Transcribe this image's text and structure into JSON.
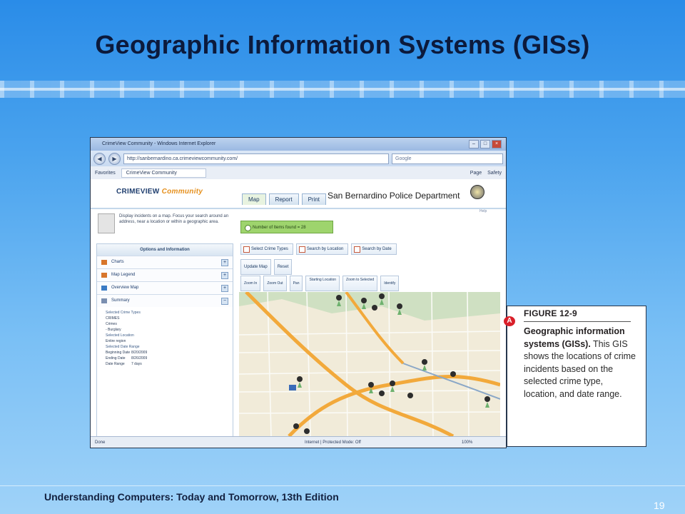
{
  "slide": {
    "title": "Geographic Information Systems (GISs)",
    "footer": "Understanding Computers: Today and Tomorrow, 13th Edition",
    "page_number": "19"
  },
  "browser": {
    "window_title": "CrimeView Community - Windows Internet Explorer",
    "url": "http://sanbernardino.ca.crimeviewcommunity.com/",
    "search_placeholder": "Google",
    "favorites_label": "Favorites",
    "tab_label": "CrimeView Community",
    "menu_page": "Page",
    "menu_safety": "Safety",
    "status_left": "Done",
    "status_zone": "Internet | Protected Mode: Off",
    "zoom": "100%"
  },
  "app": {
    "logo_main": "CRIMEVIEW",
    "logo_sub": "Community",
    "department": "San Bernardino Police Department",
    "tabs": [
      "Map",
      "Report",
      "Print"
    ],
    "help": "Help",
    "intro_text": "Display incidents on a map. Focus your search around an address, near a location or within a geographic area.",
    "incident_count": "Number of Items found = 28",
    "panel_header": "Options and Information",
    "panel_rows": [
      "Charts",
      "Map Legend",
      "Overview Map",
      "Summary"
    ],
    "summary": {
      "crime_types_head": "Selected Crime Types",
      "crimes_label": "CRIMES",
      "crimes_sub": "Crimes",
      "burglary": "- Burglary",
      "location_head": "Selected Location",
      "location_value": "Entire region",
      "date_head": "Selected Date Range",
      "beginning_label": "Beginning Date",
      "beginning_value": "8/20/2009",
      "ending_label": "Ending Date",
      "ending_value": "8/26/2009",
      "range_label": "Date Range",
      "range_value": "7 days"
    },
    "search_buttons": [
      "Select Crime Types",
      "Search by Location",
      "Search by Date"
    ],
    "action_buttons": [
      "Update Map",
      "Reset"
    ],
    "map_tools": [
      "Zoom In",
      "Zoom Out",
      "Pan",
      "Starting Location",
      "Zoom to Selected",
      "Identify"
    ]
  },
  "figure": {
    "label": "FIGURE 12-9",
    "bold_text": "Geographic information systems (GISs).",
    "body_text": "This GIS shows the locations of crime incidents based on the selected crime type, location, and date range."
  }
}
